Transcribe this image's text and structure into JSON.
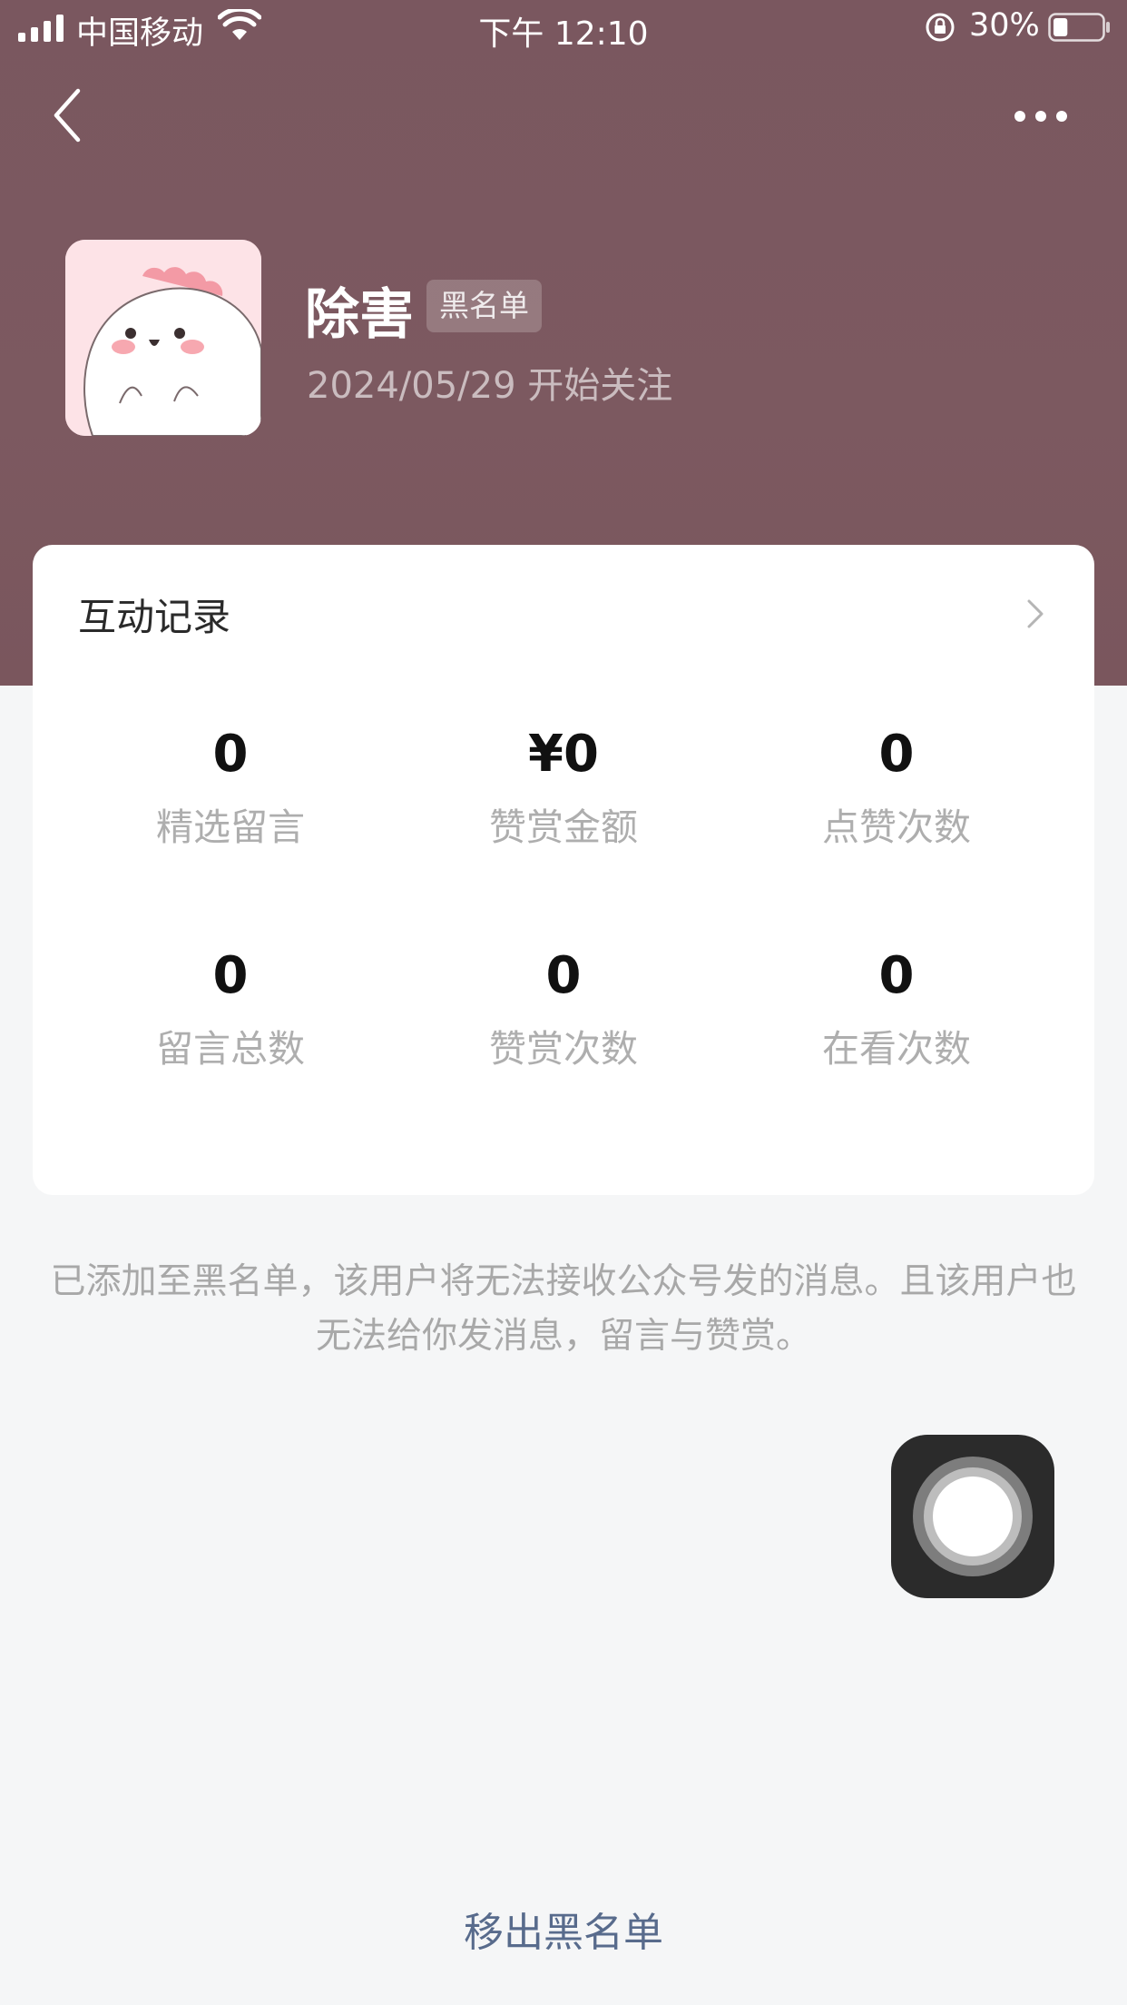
{
  "status_bar": {
    "carrier": "中国移动",
    "time": "下午 12:10",
    "battery": "30%",
    "battery_level": 0.3
  },
  "profile": {
    "name": "除害",
    "badge": "黑名单",
    "follow_date": "2024/05/29 开始关注"
  },
  "interaction": {
    "title": "互动记录",
    "stats": [
      {
        "value": "0",
        "label": "精选留言"
      },
      {
        "value": "¥0",
        "label": "赞赏金额"
      },
      {
        "value": "0",
        "label": "点赞次数"
      },
      {
        "value": "0",
        "label": "留言总数"
      },
      {
        "value": "0",
        "label": "赞赏次数"
      },
      {
        "value": "0",
        "label": "在看次数"
      }
    ]
  },
  "notice": "已添加至黑名单，该用户将无法接收公众号发的消息。且该用户也无法给你发消息，留言与赞赏。",
  "remove_button": "移出黑名单",
  "colors": {
    "header_bg": "#7a575f",
    "link": "#586b8c"
  }
}
